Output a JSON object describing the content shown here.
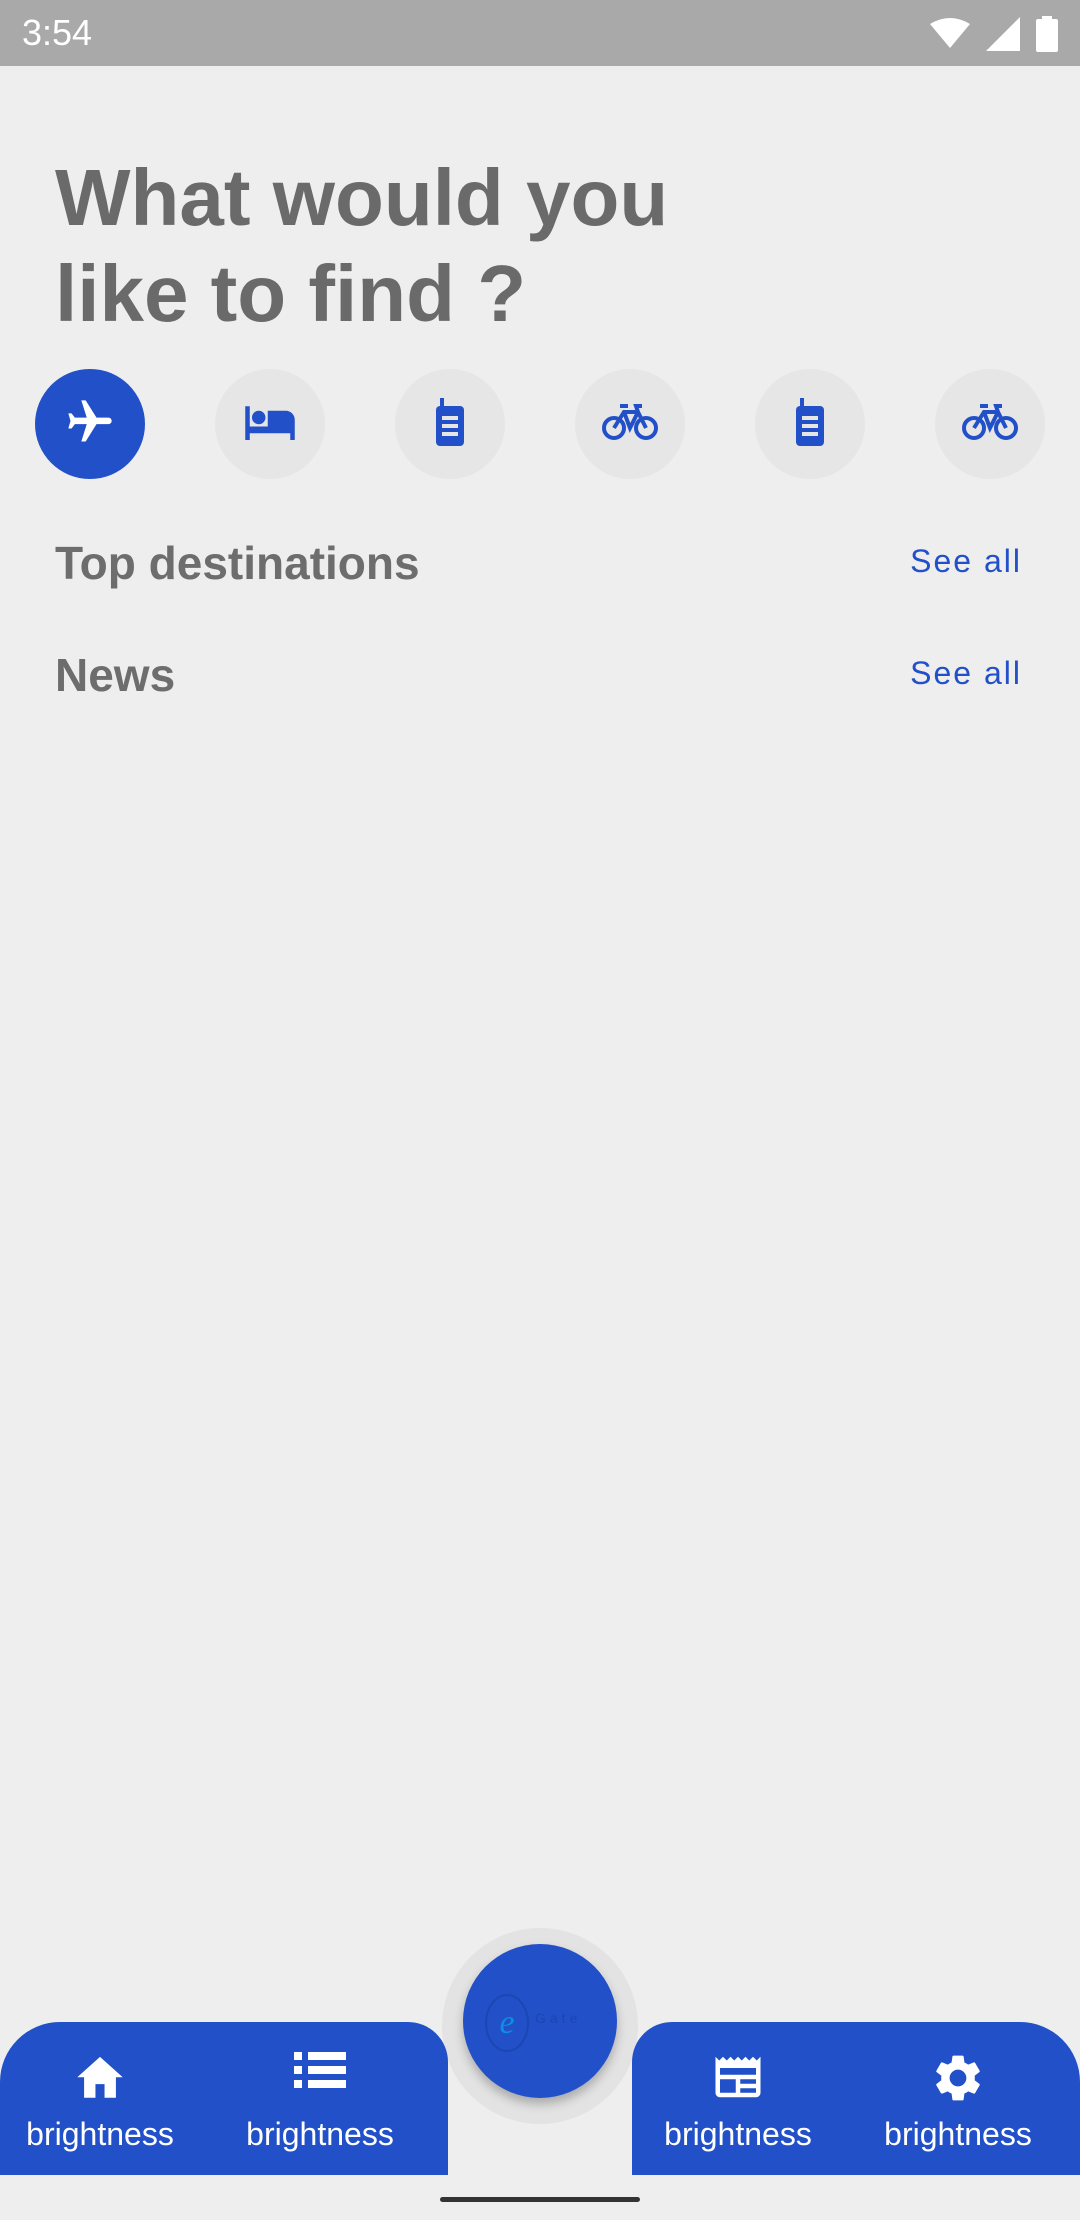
{
  "status_bar": {
    "time": "3:54",
    "icons": [
      "wifi-icon",
      "signal-icon",
      "battery-icon"
    ]
  },
  "header": {
    "line1": "What would you",
    "line2": "like to find ?"
  },
  "categories": [
    {
      "icon": "airplane-icon",
      "selected": true
    },
    {
      "icon": "hotel-bed-icon",
      "selected": false
    },
    {
      "icon": "walkie-talkie-icon",
      "selected": false
    },
    {
      "icon": "bicycle-icon",
      "selected": false
    },
    {
      "icon": "walkie-talkie-icon",
      "selected": false
    },
    {
      "icon": "bicycle-icon",
      "selected": false
    }
  ],
  "sections": {
    "top_destinations": {
      "title": "Top destinations",
      "see_all": "See all"
    },
    "news": {
      "title": "News",
      "see_all": "See all"
    }
  },
  "bottom_nav": {
    "items": [
      {
        "icon": "home-icon",
        "label": "brightness"
      },
      {
        "icon": "list-icon",
        "label": "brightness"
      },
      {
        "icon": "newspaper-icon",
        "label": "brightness"
      },
      {
        "icon": "settings-gear-icon",
        "label": "brightness"
      }
    ],
    "fab": {
      "logo_letter": "e",
      "logo_text": "Gate"
    }
  },
  "colors": {
    "primary": "#2150c8",
    "background": "#eeeeee",
    "status_bar": "#a9a9a9",
    "text_gray": "#6a6a6a",
    "chip_bg": "#e6e6e6"
  }
}
